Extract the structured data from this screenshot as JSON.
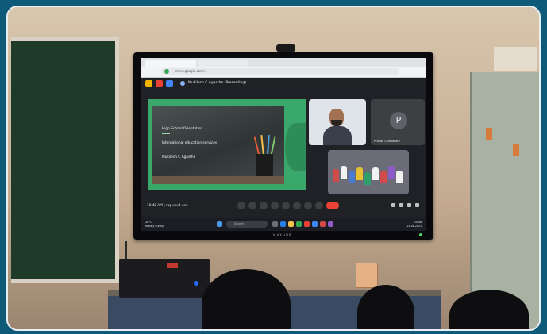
{
  "browser": {
    "url": "meet.google.com/..."
  },
  "meet": {
    "meeting_title": "Mukilesh C Agasthe (Presenting)",
    "time": "10:48 AM",
    "meeting_code": "rkg-xxxd-osn",
    "participants": [
      {
        "name": "Mukilesh C Agasthe",
        "role": "presenter-camera"
      },
      {
        "name": "Pranali Choudhary",
        "initial": "P"
      },
      {
        "name": "Classroom",
        "role": "classroom-camera"
      }
    ]
  },
  "slide": {
    "lines": [
      "High School Orientation",
      "International education services",
      "Mukilesh C Agasthe"
    ]
  },
  "taskbar": {
    "weather_temp": "28°C",
    "weather_desc": "Mostly sunny",
    "search_placeholder": "Search",
    "clock_time": "10:48",
    "clock_date": "23-08-2023"
  },
  "tv": {
    "brand": "MAXHUB"
  },
  "colors": {
    "slide_green": "#3ba86b",
    "end_call_red": "#ea4335",
    "meet_dark": "#202124"
  }
}
